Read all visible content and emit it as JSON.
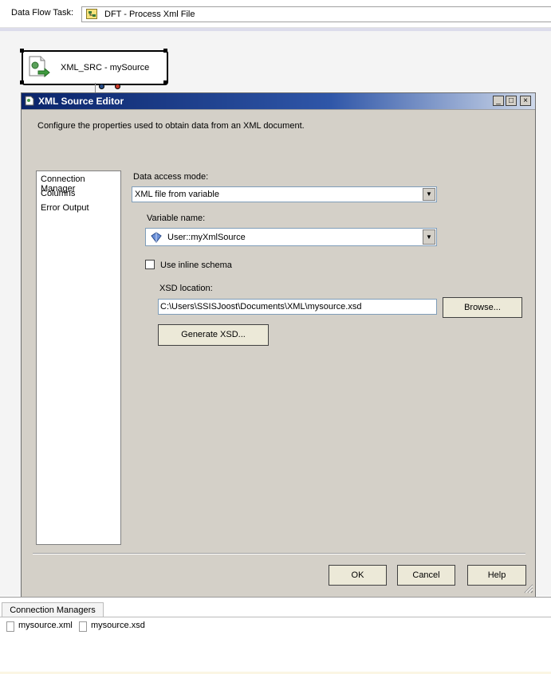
{
  "task_bar": {
    "label": "Data Flow Task:",
    "value": "DFT - Process Xml File"
  },
  "component": {
    "label": "XML_SRC - mySource"
  },
  "dialog": {
    "title": "XML Source Editor",
    "title_buttons": [
      "_",
      "□",
      "×"
    ],
    "description": "Configure the properties used to obtain data from an XML document.",
    "nav_items": [
      "Connection Manager",
      "Columns",
      "Error Output"
    ],
    "selected_nav": "Connection Manager",
    "data_access_mode_label": "Data access mode:",
    "data_access_mode_value": "XML file from variable",
    "variable_name_label": "Variable name:",
    "variable_name_value": "User::myXmlSource",
    "inline_schema_label": "Use inline schema",
    "inline_schema_checked": false,
    "xsd_location_label": "XSD location:",
    "xsd_location_value": "C:\\Users\\SSISJoost\\Documents\\XML\\mysource.xsd",
    "browse_label": "Browse...",
    "generate_xsd_label": "Generate XSD...",
    "ok_label": "OK",
    "cancel_label": "Cancel",
    "help_label": "Help"
  },
  "connection_managers": {
    "tab_label": "Connection Managers",
    "items": [
      "mysource.xml",
      "mysource.xsd"
    ]
  },
  "colors": {
    "title_bar": "#0a246a",
    "dialog_face": "#d4d0c8"
  }
}
